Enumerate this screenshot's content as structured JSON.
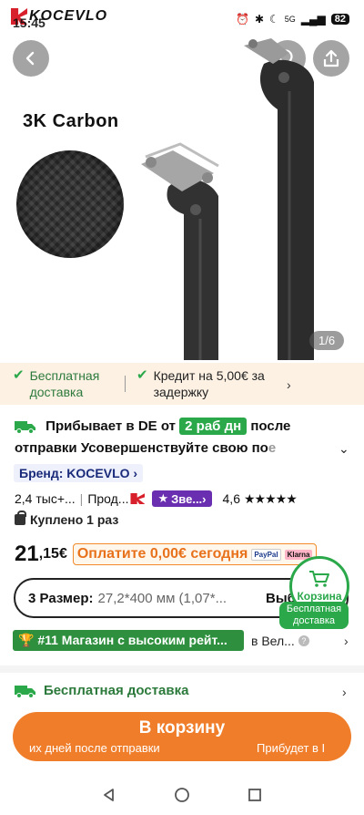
{
  "status": {
    "time": "15:45",
    "network": "5G",
    "battery": "82"
  },
  "brand": {
    "logo_text": "KOCEVLO"
  },
  "hero": {
    "carbon_label": "3K Carbon",
    "pager": "1/6"
  },
  "benefits": {
    "item1": "Бесплатная доставка",
    "item2": "Кредит на 5,00€ за задержку"
  },
  "delivery": {
    "prefix": "Прибывает в DE от",
    "days": "2 раб дн",
    "suffix": "после отправки",
    "title": "Усовершенствуйте свою по",
    "title_fade": "е"
  },
  "brand_chip": "Бренд: KOCEVLO",
  "stats": {
    "sold": "2,4 тыс+...",
    "seller": "Прод...",
    "star_badge": "Зве...",
    "rating": "4,6",
    "stars": "★★★★★"
  },
  "bought": "Куплено 1 раз",
  "price": {
    "whole": "21",
    "cents": ",15€",
    "pay_now": "Оплатите 0,00€ сегодня",
    "paypal": "PayPal",
    "klarna": "Klarna"
  },
  "size": {
    "label": "3 Размер:",
    "value": "27,2*400 мм (1,07*...",
    "choose": "Выб"
  },
  "cart_fab": {
    "label": "Корзина",
    "tag": "Бесплатная доставка"
  },
  "shop": {
    "badge": "#11 Магазин с высоким рейт...",
    "location": "в Вел..."
  },
  "free_shipping": "Бесплатная доставка",
  "cart_button": {
    "label": "В корзину",
    "sub_left": "их дней после отправки",
    "sub_right": "Прибудет в I"
  },
  "colors": {
    "accent_orange": "#f07d2a",
    "green": "#2aa84a",
    "purple": "#6a2fb0"
  }
}
